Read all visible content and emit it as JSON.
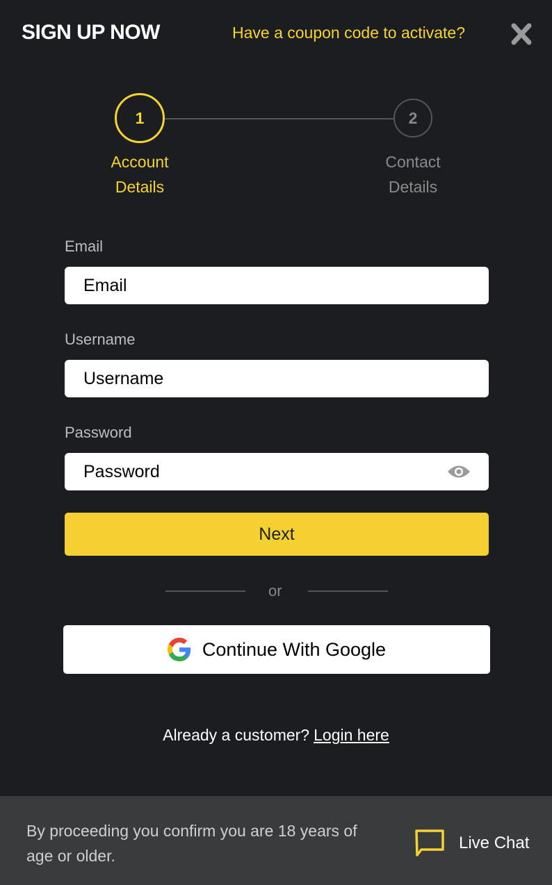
{
  "header": {
    "title": "SIGN UP NOW",
    "coupon_link": "Have a coupon code to activate?",
    "close_icon": "close-icon"
  },
  "steps": [
    {
      "number": "1",
      "label_line1": "Account",
      "label_line2": "Details",
      "active": true
    },
    {
      "number": "2",
      "label_line1": "Contact",
      "label_line2": "Details",
      "active": false
    }
  ],
  "form": {
    "email": {
      "label": "Email",
      "placeholder": "Email"
    },
    "username": {
      "label": "Username",
      "placeholder": "Username"
    },
    "password": {
      "label": "Password",
      "placeholder": "Password",
      "toggle_icon": "eye-icon"
    },
    "next_label": "Next",
    "or_label": "or",
    "google_label": "Continue With Google"
  },
  "login": {
    "prompt": "Already a customer?",
    "link": "Login here"
  },
  "footer": {
    "disclaimer": "By proceeding you confirm you are 18 years of age or older.",
    "chat_label": "Live Chat"
  },
  "colors": {
    "accent": "#f5d330",
    "background": "#1b1d20",
    "footer": "#3a3b3c"
  }
}
